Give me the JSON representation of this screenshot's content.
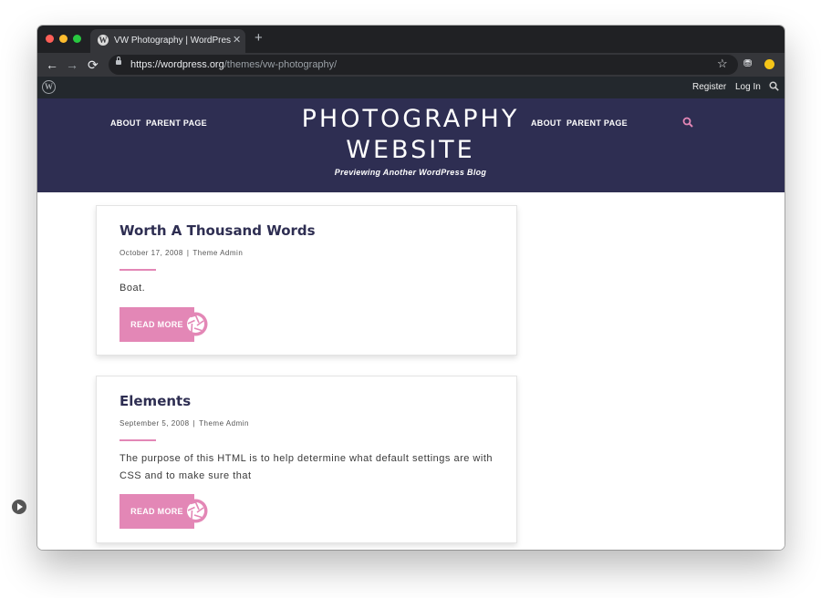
{
  "browser": {
    "tab_title": "VW Photography | WordPress.o",
    "tab_close": "✕",
    "new_tab": "+",
    "nav": {
      "back": "←",
      "forward": "→",
      "reload": "⟳"
    },
    "url_host": "https://wordpress.org",
    "url_path": "/themes/vw-photography/",
    "star": "☆",
    "extension": "⛃"
  },
  "admin_bar": {
    "logo": "W",
    "register": "Register",
    "login": "Log In"
  },
  "site": {
    "menu_left": [
      "ABOUT",
      "PARENT PAGE"
    ],
    "menu_right": [
      "ABOUT",
      "PARENT PAGE"
    ],
    "title_line1": "PHOTOGRAPHY",
    "title_line2": "WEBSITE",
    "tagline": "Previewing Another WordPress Blog"
  },
  "posts": [
    {
      "title": "Worth A Thousand Words",
      "date": "October 17, 2008",
      "separator": "|",
      "author": "Theme Admin",
      "excerpt": "Boat.",
      "read_more": "READ MORE"
    },
    {
      "title": "Elements",
      "date": "September 5, 2008",
      "separator": "|",
      "author": "Theme Admin",
      "excerpt": "The purpose of this HTML is to help determine what default settings are with CSS and to make sure that",
      "read_more": "READ MORE"
    }
  ],
  "colors": {
    "header_bg": "#2e2e52",
    "accent_pink": "#e387b6",
    "browser_dark": "#202124",
    "admin_bar": "#23282d"
  },
  "icons": [
    "wordpress-icon",
    "lock-icon",
    "star-icon",
    "search-icon",
    "aperture-icon",
    "play-icon"
  ]
}
